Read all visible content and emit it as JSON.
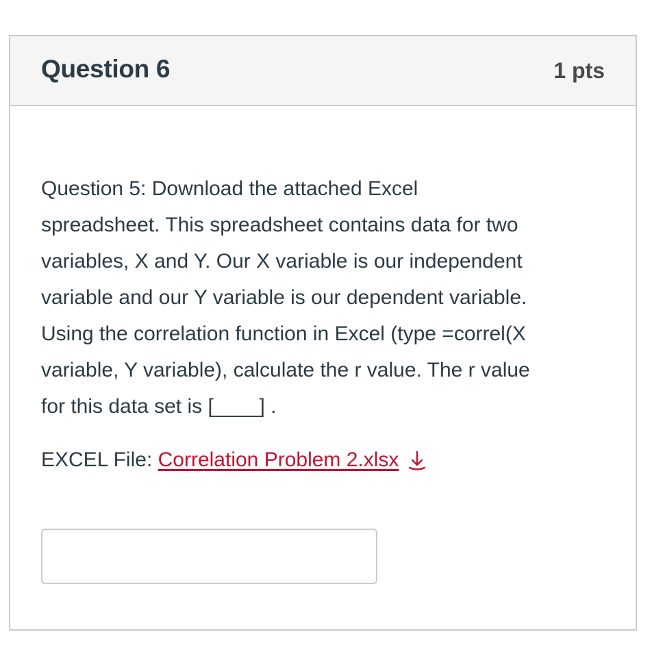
{
  "question": {
    "title": "Question 6",
    "points": "1 pts",
    "text": "Question 5: Download the attached Excel\nspreadsheet. This spreadsheet contains data for two\nvariables, X and Y. Our X variable is our independent\nvariable and our Y variable is our dependent variable.\nUsing the correlation function in Excel (type =correl(X\nvariable, Y variable), calculate the r value. The r value\nfor this data set is [____] .",
    "file_label": "EXCEL File: ",
    "file_link_text": "Correlation Problem 2.xlsx",
    "download_icon": "download-arrow-icon",
    "answer_value": ""
  },
  "colors": {
    "link": "#c4122f",
    "header_bg": "#f5f5f5",
    "border": "#c7cdd1",
    "text": "#2d3b45"
  }
}
